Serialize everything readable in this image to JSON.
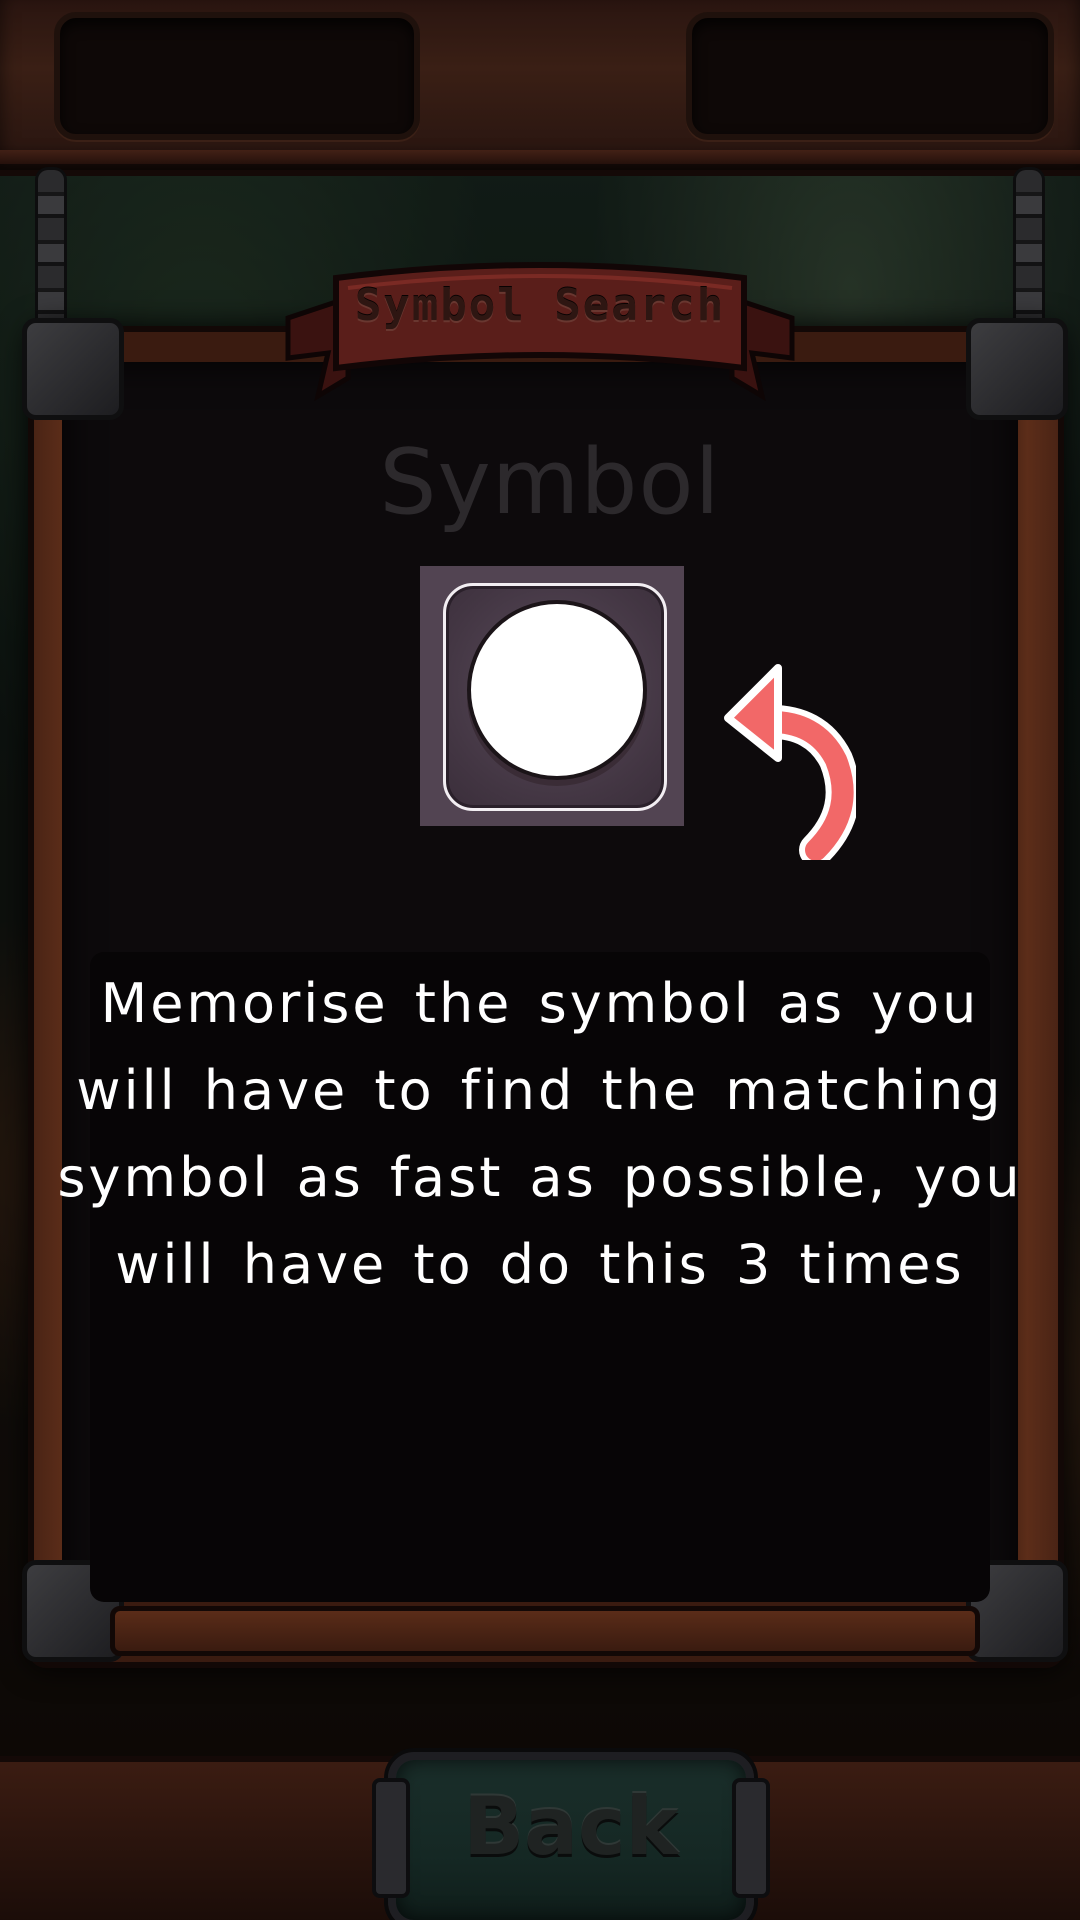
{
  "game": {
    "title": "Symbol Search",
    "section_label": "Symbol",
    "symbol_icon": "white-circle",
    "instruction": "Memorise the symbol as you will have to find the matching symbol as fast as possible, you will have to do this 3 times",
    "back_label": "Back"
  },
  "colors": {
    "arrow": "#f26868",
    "symbol_tile": "#524452",
    "instruction_text": "#ffffff",
    "panel_background": "#0d0a0c",
    "ribbon": "#5a1e1a"
  }
}
